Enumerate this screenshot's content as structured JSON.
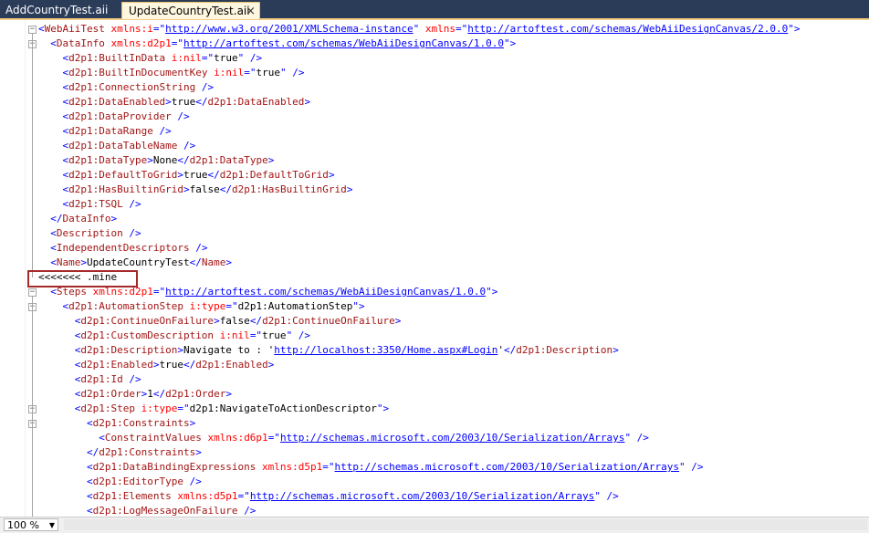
{
  "tabs": [
    {
      "label": "AddCountryTest.aii"
    },
    {
      "label": "UpdateCountryTest.aii",
      "close": "×"
    }
  ],
  "marker": "<<<<<<< .mine",
  "zoom": "100 %",
  "lines": [
    [
      [
        "b",
        "<"
      ],
      [
        "t",
        "WebAiiTest "
      ],
      [
        "a",
        "xmlns:i"
      ],
      [
        "b",
        "=\""
      ],
      [
        "u",
        "http://www.w3.org/2001/XMLSchema-instance"
      ],
      [
        "b",
        "\" "
      ],
      [
        "a",
        "xmlns"
      ],
      [
        "b",
        "=\""
      ],
      [
        "u",
        "http://artoftest.com/schemas/WebAiiDesignCanvas/2.0.0"
      ],
      [
        "b",
        "\">"
      ]
    ],
    [
      [
        "b",
        "  <"
      ],
      [
        "t",
        "DataInfo "
      ],
      [
        "a",
        "xmlns:d2p1"
      ],
      [
        "b",
        "=\""
      ],
      [
        "u",
        "http://artoftest.com/schemas/WebAiiDesignCanvas/1.0.0"
      ],
      [
        "b",
        "\">"
      ]
    ],
    [
      [
        "b",
        "    <"
      ],
      [
        "t",
        "d2p1:BuiltInData "
      ],
      [
        "a",
        "i:nil"
      ],
      [
        "b",
        "=\""
      ],
      [
        "x",
        "true"
      ],
      [
        "b",
        "\" />"
      ]
    ],
    [
      [
        "b",
        "    <"
      ],
      [
        "t",
        "d2p1:BuiltInDocumentKey "
      ],
      [
        "a",
        "i:nil"
      ],
      [
        "b",
        "=\""
      ],
      [
        "x",
        "true"
      ],
      [
        "b",
        "\" />"
      ]
    ],
    [
      [
        "b",
        "    <"
      ],
      [
        "t",
        "d2p1:ConnectionString "
      ],
      [
        "b",
        "/>"
      ]
    ],
    [
      [
        "b",
        "    <"
      ],
      [
        "t",
        "d2p1:DataEnabled"
      ],
      [
        "b",
        ">"
      ],
      [
        "x",
        "true"
      ],
      [
        "b",
        "</"
      ],
      [
        "t",
        "d2p1:DataEnabled"
      ],
      [
        "b",
        ">"
      ]
    ],
    [
      [
        "b",
        "    <"
      ],
      [
        "t",
        "d2p1:DataProvider "
      ],
      [
        "b",
        "/>"
      ]
    ],
    [
      [
        "b",
        "    <"
      ],
      [
        "t",
        "d2p1:DataRange "
      ],
      [
        "b",
        "/>"
      ]
    ],
    [
      [
        "b",
        "    <"
      ],
      [
        "t",
        "d2p1:DataTableName "
      ],
      [
        "b",
        "/>"
      ]
    ],
    [
      [
        "b",
        "    <"
      ],
      [
        "t",
        "d2p1:DataType"
      ],
      [
        "b",
        ">"
      ],
      [
        "x",
        "None"
      ],
      [
        "b",
        "</"
      ],
      [
        "t",
        "d2p1:DataType"
      ],
      [
        "b",
        ">"
      ]
    ],
    [
      [
        "b",
        "    <"
      ],
      [
        "t",
        "d2p1:DefaultToGrid"
      ],
      [
        "b",
        ">"
      ],
      [
        "x",
        "true"
      ],
      [
        "b",
        "</"
      ],
      [
        "t",
        "d2p1:DefaultToGrid"
      ],
      [
        "b",
        ">"
      ]
    ],
    [
      [
        "b",
        "    <"
      ],
      [
        "t",
        "d2p1:HasBuiltinGrid"
      ],
      [
        "b",
        ">"
      ],
      [
        "x",
        "false"
      ],
      [
        "b",
        "</"
      ],
      [
        "t",
        "d2p1:HasBuiltinGrid"
      ],
      [
        "b",
        ">"
      ]
    ],
    [
      [
        "b",
        "    <"
      ],
      [
        "t",
        "d2p1:TSQL "
      ],
      [
        "b",
        "/>"
      ]
    ],
    [
      [
        "b",
        "  </"
      ],
      [
        "t",
        "DataInfo"
      ],
      [
        "b",
        ">"
      ]
    ],
    [
      [
        "b",
        "  <"
      ],
      [
        "t",
        "Description "
      ],
      [
        "b",
        "/>"
      ]
    ],
    [
      [
        "b",
        "  <"
      ],
      [
        "t",
        "IndependentDescriptors "
      ],
      [
        "b",
        "/>"
      ]
    ],
    [
      [
        "b",
        "  <"
      ],
      [
        "t",
        "Name"
      ],
      [
        "b",
        ">"
      ],
      [
        "x",
        "UpdateCountryTest"
      ],
      [
        "b",
        "</"
      ],
      [
        "t",
        "Name"
      ],
      [
        "b",
        ">"
      ]
    ],
    [],
    [
      [
        "b",
        "  <"
      ],
      [
        "t",
        "Steps "
      ],
      [
        "a",
        "xmlns:d2p1"
      ],
      [
        "b",
        "=\""
      ],
      [
        "u",
        "http://artoftest.com/schemas/WebAiiDesignCanvas/1.0.0"
      ],
      [
        "b",
        "\">"
      ]
    ],
    [
      [
        "b",
        "    <"
      ],
      [
        "t",
        "d2p1:AutomationStep "
      ],
      [
        "a",
        "i:type"
      ],
      [
        "b",
        "=\""
      ],
      [
        "x",
        "d2p1:AutomationStep"
      ],
      [
        "b",
        "\">"
      ]
    ],
    [
      [
        "b",
        "      <"
      ],
      [
        "t",
        "d2p1:ContinueOnFailure"
      ],
      [
        "b",
        ">"
      ],
      [
        "x",
        "false"
      ],
      [
        "b",
        "</"
      ],
      [
        "t",
        "d2p1:ContinueOnFailure"
      ],
      [
        "b",
        ">"
      ]
    ],
    [
      [
        "b",
        "      <"
      ],
      [
        "t",
        "d2p1:CustomDescription "
      ],
      [
        "a",
        "i:nil"
      ],
      [
        "b",
        "=\""
      ],
      [
        "x",
        "true"
      ],
      [
        "b",
        "\" />"
      ]
    ],
    [
      [
        "b",
        "      <"
      ],
      [
        "t",
        "d2p1:Description"
      ],
      [
        "b",
        ">"
      ],
      [
        "x",
        "Navigate to : '"
      ],
      [
        "u",
        "http://localhost:3350/Home.aspx#Login"
      ],
      [
        "x",
        "'"
      ],
      [
        "b",
        "</"
      ],
      [
        "t",
        "d2p1:Description"
      ],
      [
        "b",
        ">"
      ]
    ],
    [
      [
        "b",
        "      <"
      ],
      [
        "t",
        "d2p1:Enabled"
      ],
      [
        "b",
        ">"
      ],
      [
        "x",
        "true"
      ],
      [
        "b",
        "</"
      ],
      [
        "t",
        "d2p1:Enabled"
      ],
      [
        "b",
        ">"
      ]
    ],
    [
      [
        "b",
        "      <"
      ],
      [
        "t",
        "d2p1:Id "
      ],
      [
        "b",
        "/>"
      ]
    ],
    [
      [
        "b",
        "      <"
      ],
      [
        "t",
        "d2p1:Order"
      ],
      [
        "b",
        ">"
      ],
      [
        "x",
        "1"
      ],
      [
        "b",
        "</"
      ],
      [
        "t",
        "d2p1:Order"
      ],
      [
        "b",
        ">"
      ]
    ],
    [
      [
        "b",
        "      <"
      ],
      [
        "t",
        "d2p1:Step "
      ],
      [
        "a",
        "i:type"
      ],
      [
        "b",
        "=\""
      ],
      [
        "x",
        "d2p1:NavigateToActionDescriptor"
      ],
      [
        "b",
        "\">"
      ]
    ],
    [
      [
        "b",
        "        <"
      ],
      [
        "t",
        "d2p1:Constraints"
      ],
      [
        "b",
        ">"
      ]
    ],
    [
      [
        "b",
        "          <"
      ],
      [
        "t",
        "ConstraintValues "
      ],
      [
        "a",
        "xmlns:d6p1"
      ],
      [
        "b",
        "=\""
      ],
      [
        "u",
        "http://schemas.microsoft.com/2003/10/Serialization/Arrays"
      ],
      [
        "b",
        "\" />"
      ]
    ],
    [
      [
        "b",
        "        </"
      ],
      [
        "t",
        "d2p1:Constraints"
      ],
      [
        "b",
        ">"
      ]
    ],
    [
      [
        "b",
        "        <"
      ],
      [
        "t",
        "d2p1:DataBindingExpressions "
      ],
      [
        "a",
        "xmlns:d5p1"
      ],
      [
        "b",
        "=\""
      ],
      [
        "u",
        "http://schemas.microsoft.com/2003/10/Serialization/Arrays"
      ],
      [
        "b",
        "\" />"
      ]
    ],
    [
      [
        "b",
        "        <"
      ],
      [
        "t",
        "d2p1:EditorType "
      ],
      [
        "b",
        "/>"
      ]
    ],
    [
      [
        "b",
        "        <"
      ],
      [
        "t",
        "d2p1:Elements "
      ],
      [
        "a",
        "xmlns:d5p1"
      ],
      [
        "b",
        "=\""
      ],
      [
        "u",
        "http://schemas.microsoft.com/2003/10/Serialization/Arrays"
      ],
      [
        "b",
        "\" />"
      ]
    ],
    [
      [
        "b",
        "        <"
      ],
      [
        "t",
        "d2p1:LogMessageOnFailure "
      ],
      [
        "b",
        "/>"
      ]
    ]
  ]
}
